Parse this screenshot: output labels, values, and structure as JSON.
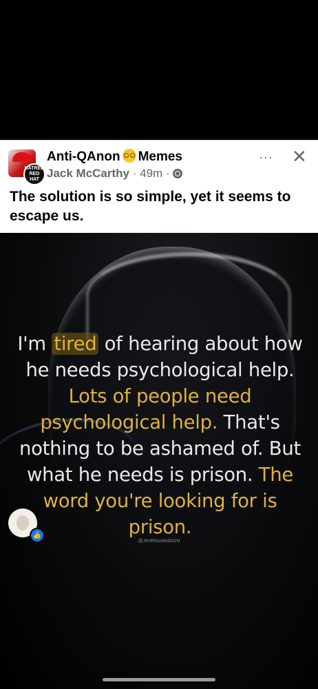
{
  "post": {
    "group_name_left": "Anti-QAnon",
    "group_name_right": "Memes",
    "author": "Jack McCarthy",
    "time": "49m",
    "text": "The solution is so simple, yet it seems to escape us.",
    "avatar_text": "HATRED RED HAT",
    "more_label": "···",
    "close_label": "✕"
  },
  "image": {
    "quote_parts": [
      {
        "text": "I'm ",
        "style": "plain"
      },
      {
        "text": "tired",
        "style": "tired"
      },
      {
        "text": " of hearing about how he needs psychological help. ",
        "style": "plain"
      },
      {
        "text": "Lots of people need psychological help.",
        "style": "hl"
      },
      {
        "text": " That's nothing to be ashamed of. But what he needs is prison. ",
        "style": "plain"
      },
      {
        "text": "The word you're looking for is prison.",
        "style": "hl"
      }
    ],
    "credit": "@JenResistedAGN"
  },
  "colors": {
    "highlight": "#e0b23a",
    "like_blue": "#1877f2"
  }
}
